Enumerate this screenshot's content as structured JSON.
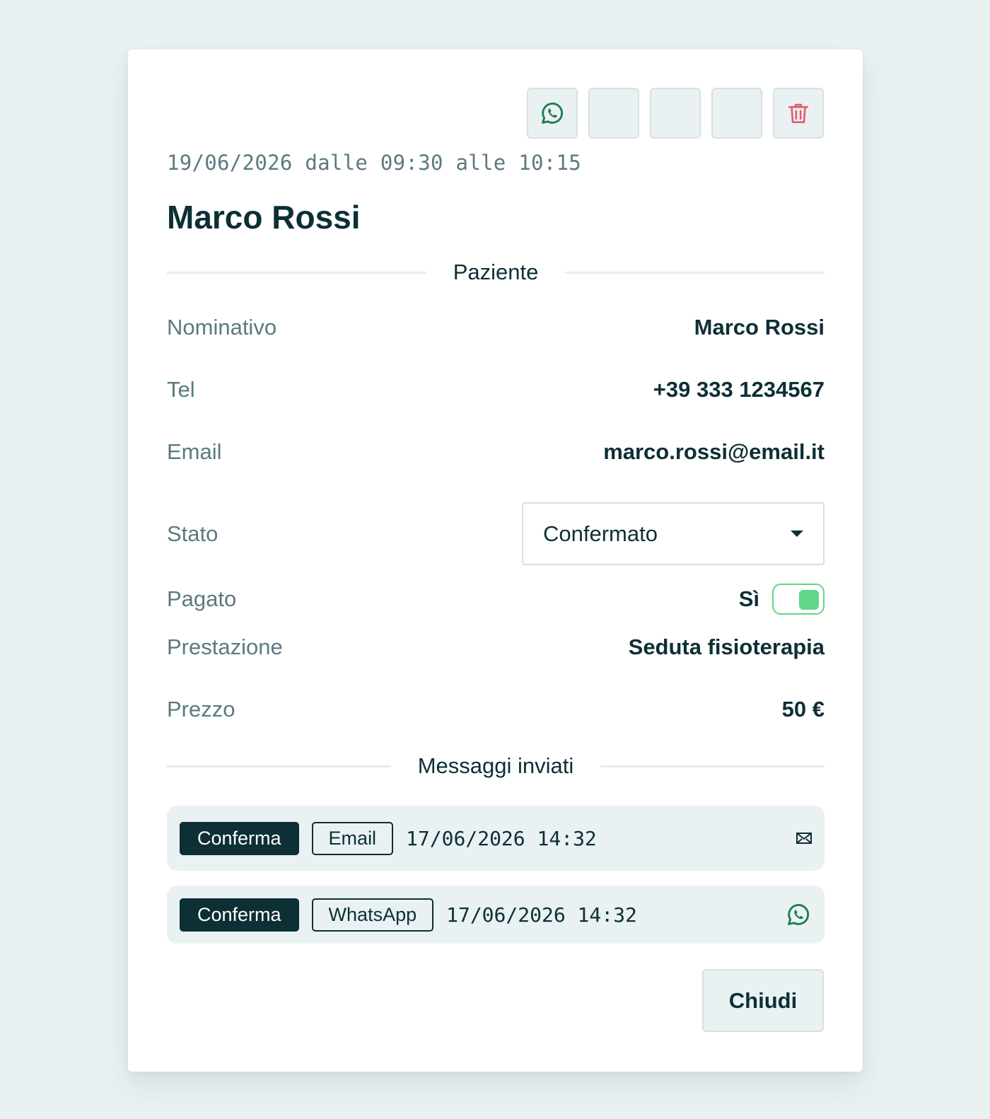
{
  "appointment": {
    "datetime": "19/06/2026 dalle 09:30 alle 10:15",
    "title": "Marco Rossi"
  },
  "toolbar": {
    "buttons": [
      {
        "icon": "whatsapp-icon"
      },
      {
        "icon": ""
      },
      {
        "icon": ""
      },
      {
        "icon": ""
      },
      {
        "icon": "trash-icon"
      }
    ]
  },
  "patient": {
    "section_label": "Paziente",
    "name_label": "Nominativo",
    "name_value": "Marco Rossi",
    "tel_label": "Tel",
    "tel_value": "+39 333 1234567",
    "email_label": "Email",
    "email_value": "marco.rossi@email.it",
    "status_label": "Stato",
    "status_value": "Confermato",
    "paid_label": "Pagato",
    "paid_value": "Sì",
    "paid_on": true,
    "service_label": "Prestazione",
    "service_value": "Seduta fisioterapia",
    "price_label": "Prezzo",
    "price_value": "50 €"
  },
  "messages": {
    "section_label": "Messaggi inviati",
    "items": [
      {
        "type": "Conferma",
        "channel": "Email",
        "time": "17/06/2026 14:32",
        "icon": "envelope-icon"
      },
      {
        "type": "Conferma",
        "channel": "WhatsApp",
        "time": "17/06/2026 14:32",
        "icon": "whatsapp-icon"
      }
    ]
  },
  "actions": {
    "close_label": "Chiudi"
  },
  "colors": {
    "primary": "#0d2f36",
    "muted": "#5b7a80",
    "background": "#e9f1f3",
    "whatsapp": "#1e7d4a",
    "danger": "#e0606e",
    "toggle_on": "#5fd688"
  }
}
